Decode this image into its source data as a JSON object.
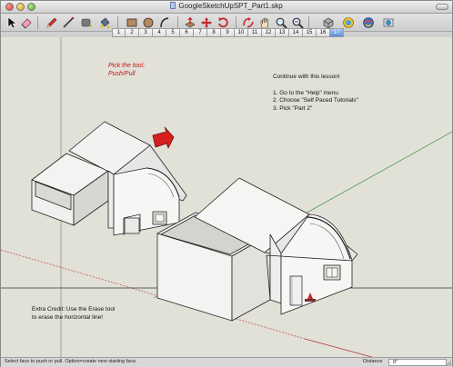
{
  "window": {
    "title": "GoogleSketchUpSPT_Part1.skp"
  },
  "toolbar": {
    "tools": [
      {
        "name": "select-tool-icon"
      },
      {
        "name": "eraser-tool-icon"
      },
      {
        "name": "pencil-tool-icon"
      },
      {
        "name": "line-tool-icon"
      },
      {
        "name": "tape-measure-tool-icon"
      },
      {
        "name": "paint-bucket-tool-icon"
      },
      {
        "name": "rectangle-tool-icon"
      },
      {
        "name": "circle-tool-icon"
      },
      {
        "name": "arc-tool-icon"
      },
      {
        "name": "push-pull-tool-icon"
      },
      {
        "name": "move-tool-icon"
      },
      {
        "name": "rotate-tool-icon"
      },
      {
        "name": "orbit-tool-icon"
      },
      {
        "name": "pan-tool-icon"
      },
      {
        "name": "zoom-tool-icon"
      },
      {
        "name": "zoom-extents-tool-icon"
      },
      {
        "name": "components-icon"
      },
      {
        "name": "get-models-icon"
      },
      {
        "name": "share-model-icon"
      },
      {
        "name": "google-earth-icon"
      }
    ]
  },
  "scenes": {
    "tabs": [
      "1",
      "2",
      "3",
      "4",
      "5",
      "6",
      "7",
      "8",
      "9",
      "10",
      "11",
      "12",
      "13",
      "14",
      "15",
      "16",
      "17"
    ],
    "active_index": 16
  },
  "viewport": {
    "tool_hint_line1": "Pick the tool:",
    "tool_hint_line2": "Push/Pull",
    "lesson_intro": "Continue with this lesson!",
    "lesson_steps": [
      "1. Go to the \"Help\" menu",
      "2. Choose \"Self Paced Tutorials\"",
      "3. Pick \"Part 2\""
    ],
    "credit_line1": "Extra Credit: Use the Erase tool",
    "credit_line2": "to erase the horizontal line!"
  },
  "status": {
    "message": "Select face to push or pull. Option=create new starting face.",
    "measure_label": "Distance",
    "measure_value": "0\""
  },
  "colors": {
    "viewport_bg": "#e2e1d8",
    "red_axis": "#b22a2a",
    "green_axis": "#2f8a2f",
    "hint_red": "#c01616",
    "active_scene": "#5d8fd3"
  }
}
